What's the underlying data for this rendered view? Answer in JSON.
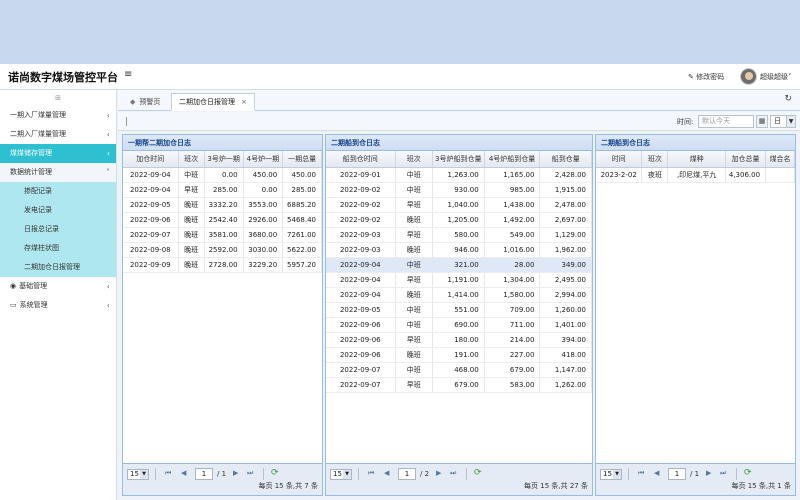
{
  "app": {
    "title": "诺尚数字煤场管控平台",
    "menu_icon": "≡"
  },
  "header": {
    "change_password": "修改密码",
    "user": "超级超级"
  },
  "sidebar": {
    "items": [
      {
        "label": "一期入厂煤量管理"
      },
      {
        "label": "二期入厂煤量管理"
      },
      {
        "label": "煤煤储存管理"
      },
      {
        "label": "数据统计管理"
      }
    ],
    "sub_items": [
      {
        "label": "掺配记录"
      },
      {
        "label": "发电记录"
      },
      {
        "label": "日报总记录"
      },
      {
        "label": "存煤柱状图"
      },
      {
        "label": "二期加仓日报管理"
      }
    ],
    "bottom_items": [
      {
        "label": "基础管理"
      },
      {
        "label": "系统管理"
      }
    ]
  },
  "tabs": {
    "home": "预警页",
    "active": "二期加仓日报管理"
  },
  "filter": {
    "label": "时间:",
    "placeholder": "默认今天",
    "select": "日"
  },
  "panel1": {
    "title": "一期帮二期加仓日志",
    "columns": [
      "加仓时间",
      "班次",
      "3号炉一期",
      "4号炉一期",
      "一期总量"
    ],
    "rows": [
      [
        "2022-09-04",
        "中班",
        "0.00",
        "450.00",
        "450.00"
      ],
      [
        "2022-09-04",
        "早班",
        "285.00",
        "0.00",
        "285.00"
      ],
      [
        "2022-09-05",
        "晚班",
        "3332.20",
        "3553.00",
        "6885.20"
      ],
      [
        "2022-09-06",
        "晚班",
        "2542.40",
        "2926.00",
        "5468.40"
      ],
      [
        "2022-09-07",
        "晚班",
        "3581.00",
        "3680.00",
        "7261.00"
      ],
      [
        "2022-09-08",
        "晚班",
        "2592.00",
        "3030.00",
        "5622.00"
      ],
      [
        "2022-09-09",
        "晚班",
        "2728.00",
        "3229.20",
        "5957.20"
      ]
    ],
    "pager": {
      "size": "15",
      "page": "1",
      "total_pages": "/ 1",
      "info": "每页 15 条,共 7 条"
    }
  },
  "panel2": {
    "title": "二期船到仓日志",
    "columns": [
      "船到仓时间",
      "班次",
      "3号炉船到仓量",
      "4号炉船到仓量",
      "船到仓量"
    ],
    "rows": [
      [
        "2022-09-01",
        "中班",
        "1,263.00",
        "1,165.00",
        "2,428.00"
      ],
      [
        "2022-09-02",
        "中班",
        "930.00",
        "985.00",
        "1,915.00"
      ],
      [
        "2022-09-02",
        "早班",
        "1,040.00",
        "1,438.00",
        "2,478.00"
      ],
      [
        "2022-09-02",
        "晚班",
        "1,205.00",
        "1,492.00",
        "2,697.00"
      ],
      [
        "2022-09-03",
        "早班",
        "580.00",
        "549.00",
        "1,129.00"
      ],
      [
        "2022-09-03",
        "晚班",
        "946.00",
        "1,016.00",
        "1,962.00"
      ],
      [
        "2022-09-04",
        "中班",
        "321.00",
        "28.00",
        "349.00"
      ],
      [
        "2022-09-04",
        "早班",
        "1,191.00",
        "1,304.00",
        "2,495.00"
      ],
      [
        "2022-09-04",
        "晚班",
        "1,414.00",
        "1,580.00",
        "2,994.00"
      ],
      [
        "2022-09-05",
        "中班",
        "551.00",
        "709.00",
        "1,260.00"
      ],
      [
        "2022-09-06",
        "中班",
        "690.00",
        "711.00",
        "1,401.00"
      ],
      [
        "2022-09-06",
        "早班",
        "180.00",
        "214.00",
        "394.00"
      ],
      [
        "2022-09-06",
        "晚班",
        "191.00",
        "227.00",
        "418.00"
      ],
      [
        "2022-09-07",
        "中班",
        "468.00",
        "679.00",
        "1,147.00"
      ],
      [
        "2022-09-07",
        "早班",
        "679.00",
        "583.00",
        "1,262.00"
      ]
    ],
    "selected_row": 6,
    "pager": {
      "size": "15",
      "page": "1",
      "total_pages": "/ 2",
      "info": "每页 15 条,共 27 条"
    }
  },
  "panel3": {
    "title": "二期船到仓日志",
    "columns": [
      "时间",
      "班次",
      "煤种",
      "加仓总量",
      "煤合名"
    ],
    "rows": [
      [
        "2023-2-02",
        "夜班",
        ",印尼煤,平九",
        "4,306.00",
        ""
      ]
    ],
    "pager": {
      "size": "15",
      "page": "1",
      "total_pages": "/ 1",
      "info": "每页 15 条,共 1 条"
    }
  }
}
